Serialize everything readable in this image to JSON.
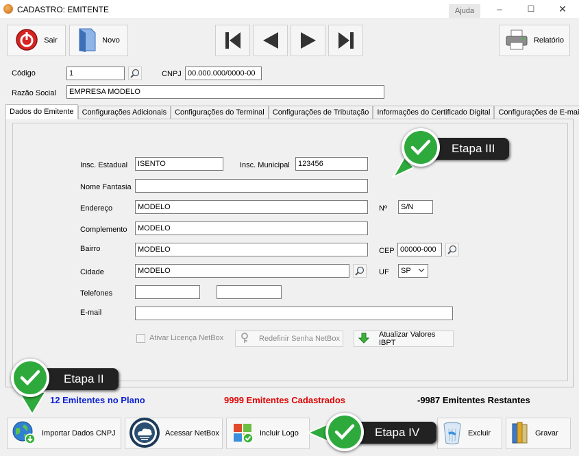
{
  "window": {
    "title": "CADASTRO: EMITENTE",
    "help": "Ajuda",
    "minimize": "–",
    "maximize": "☐",
    "close": "✕"
  },
  "toolbar": {
    "exit": "Sair",
    "new": "Novo",
    "report": "Relatório"
  },
  "header": {
    "codigo_label": "Código",
    "codigo_value": "1",
    "cnpj_label": "CNPJ",
    "cnpj_value": "00.000.000/0000-00",
    "razao_label": "Razão Social",
    "razao_value": "EMPRESA MODELO"
  },
  "tabs": [
    {
      "label": "Dados do Emitente",
      "active": true
    },
    {
      "label": "Configurações Adicionais"
    },
    {
      "label": "Configurações do Terminal"
    },
    {
      "label": "Configurações de Tributação"
    },
    {
      "label": "Informações do Certificado Digital"
    },
    {
      "label": "Configurações de E-mail"
    }
  ],
  "form": {
    "ie_label": "Insc. Estadual",
    "ie_value": "ISENTO",
    "im_label": "Insc. Municipal",
    "im_value": "123456",
    "fantasia_label": "Nome Fantasia",
    "fantasia_value": "",
    "endereco_label": "Endereço",
    "endereco_value": "MODELO",
    "numero_label": "Nº",
    "numero_value": "S/N",
    "complemento_label": "Complemento",
    "complemento_value": "MODELO",
    "bairro_label": "Bairro",
    "bairro_value": "MODELO",
    "cep_label": "CEP",
    "cep_value": "00000-000",
    "cidade_label": "Cidade",
    "cidade_value": "MODELO",
    "uf_label": "UF",
    "uf_value": "SP",
    "telefones_label": "Telefones",
    "tel1_value": "",
    "tel2_value": "",
    "email_label": "E-mail",
    "email_value": "",
    "licenca_label": "Ativar Licença NetBox",
    "redefinir_label": "Redefinir Senha NetBox",
    "ibpt_label": "Atualizar Valores IBPT"
  },
  "stats": {
    "plano": "12 Emitentes no Plano",
    "cadastrados": "9999 Emitentes Cadastrados",
    "restantes": "-9987 Emitentes Restantes",
    "plano_color": "#0a1fd4",
    "cadastrados_color": "#e00000",
    "restantes_color": "#000000"
  },
  "bottom": {
    "importar": "Importar Dados CNPJ",
    "netbox": "Acessar NetBox",
    "logo": "Incluir Logo",
    "excluir": "Excluir",
    "gravar": "Gravar"
  },
  "callouts": {
    "etapa2": "Etapa II",
    "etapa3": "Etapa III",
    "etapa4": "Etapa IV"
  },
  "icons": [
    "power-icon",
    "new-doc-icon",
    "first-icon",
    "prev-icon",
    "next-icon",
    "last-icon",
    "printer-icon",
    "search-icon",
    "globe-download-icon",
    "cloud-icon",
    "logo-icon",
    "trash-icon",
    "books-icon",
    "key-icon",
    "download-arrow-icon",
    "check-icon"
  ]
}
